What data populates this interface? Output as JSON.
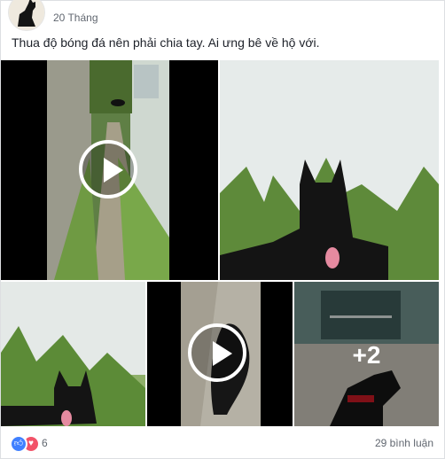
{
  "post": {
    "timestamp": "20 Tháng",
    "text": "Thua độ bóng đá nên phải chia tay. Ai ưng bê về hộ với."
  },
  "media": {
    "more_count": "+2"
  },
  "footer": {
    "reactions_count": "6",
    "comments": "29 bình luận"
  },
  "icons": {
    "like": "thumbs-up-icon",
    "love": "heart-icon",
    "play": "play-icon"
  },
  "colors": {
    "like": "#4080ff",
    "love": "#f25268",
    "meta_text": "#616770"
  }
}
